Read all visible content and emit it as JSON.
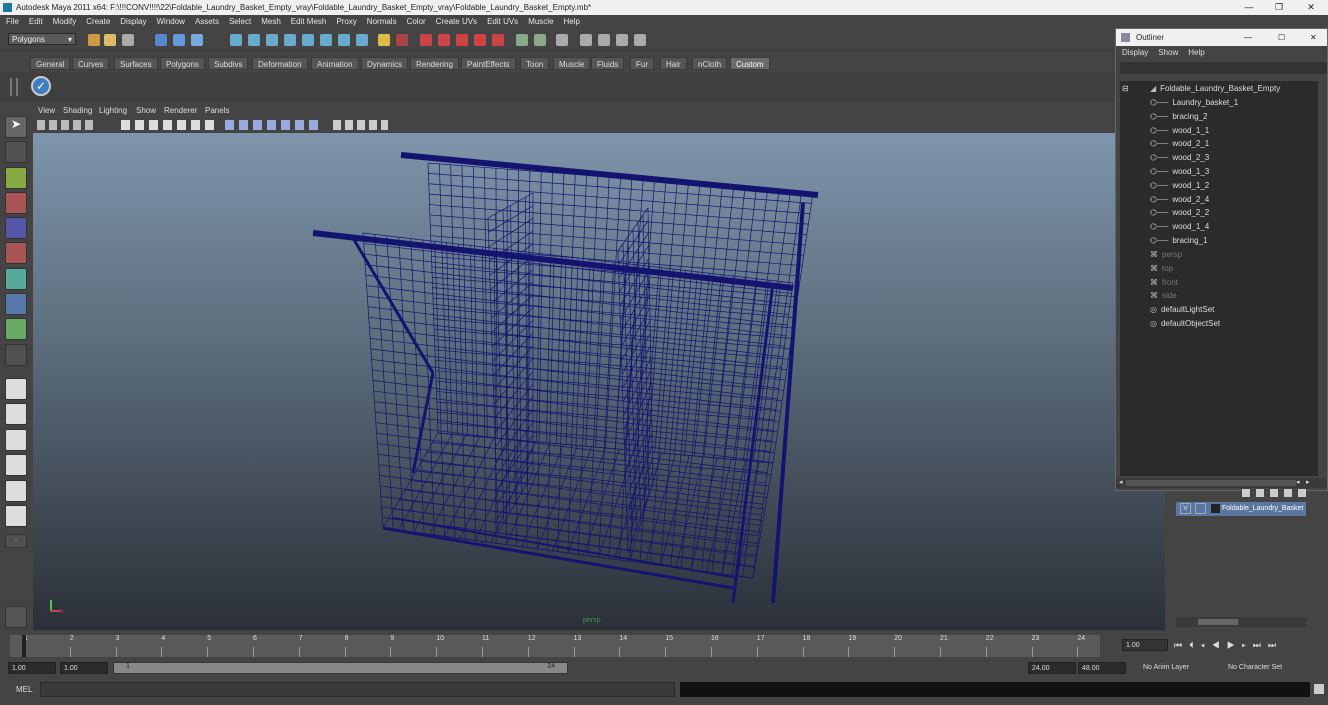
{
  "window": {
    "title": "Autodesk Maya 2011 x64: F:\\!!!CONV!!!!\\22\\Foldable_Laundry_Basket_Empty_vray\\Foldable_Laundry_Basket_Empty_vray\\Foldable_Laundry_Basket_Empty.mb*",
    "controls": {
      "minimize": "—",
      "maximize": "❐",
      "close": "✕"
    }
  },
  "menubar": [
    "File",
    "Edit",
    "Modify",
    "Create",
    "Display",
    "Window",
    "Assets",
    "Select",
    "Mesh",
    "Edit Mesh",
    "Proxy",
    "Normals",
    "Color",
    "Create UVs",
    "Edit UVs",
    "Muscle",
    "Help"
  ],
  "toolbar": {
    "mode_select": "Polygons"
  },
  "shelf_tabs": [
    {
      "label": "General"
    },
    {
      "label": "Curves"
    },
    {
      "label": "Surfaces"
    },
    {
      "label": "Polygons"
    },
    {
      "label": "Subdivs"
    },
    {
      "label": "Deformation"
    },
    {
      "label": "Animation"
    },
    {
      "label": "Dynamics"
    },
    {
      "label": "Rendering"
    },
    {
      "label": "PaintEffects"
    },
    {
      "label": "Toon"
    },
    {
      "label": "Muscle"
    },
    {
      "label": "Fluids"
    },
    {
      "label": "Fur"
    },
    {
      "label": "Hair"
    },
    {
      "label": "nCloth"
    },
    {
      "label": "Custom",
      "active": true
    }
  ],
  "viewport": {
    "menu": [
      "View",
      "Shading",
      "Lighting",
      "Show",
      "Renderer",
      "Panels"
    ],
    "camera_label": "persp",
    "axis": {
      "x": "x",
      "y": "y"
    },
    "wire_color": "#141470"
  },
  "outliner": {
    "title": "Outliner",
    "menu": [
      "Display",
      "Show",
      "Help"
    ],
    "root": "Foldable_Laundry_Basket_Empty",
    "children": [
      "Laundry_basket_1",
      "bracing_2",
      "wood_1_1",
      "wood_2_1",
      "wood_2_3",
      "wood_1_3",
      "wood_1_2",
      "wood_2_4",
      "wood_2_2",
      "wood_1_4",
      "bracing_1"
    ],
    "cameras": [
      "persp",
      "top",
      "front",
      "side"
    ],
    "sets": [
      "defaultLightSet",
      "defaultObjectSet"
    ]
  },
  "layers": {
    "row": {
      "visible": "V",
      "name": "Foldable_Laundry_Basket"
    }
  },
  "timeline": {
    "ticks": [
      "1",
      "2",
      "3",
      "4",
      "5",
      "6",
      "7",
      "8",
      "9",
      "10",
      "11",
      "12",
      "13",
      "14",
      "15",
      "16",
      "17",
      "18",
      "19",
      "20",
      "21",
      "22",
      "23",
      "24"
    ],
    "current_frame": "1.00",
    "range_start": "1.00",
    "range_start2": "1.00",
    "range_inner_start": "1",
    "range_inner_end": "24",
    "end": "24.00",
    "end2": "48.00",
    "anim_layer": "No Anim Layer",
    "char_set": "No Character Set"
  },
  "cmdline": {
    "label": "MEL"
  }
}
